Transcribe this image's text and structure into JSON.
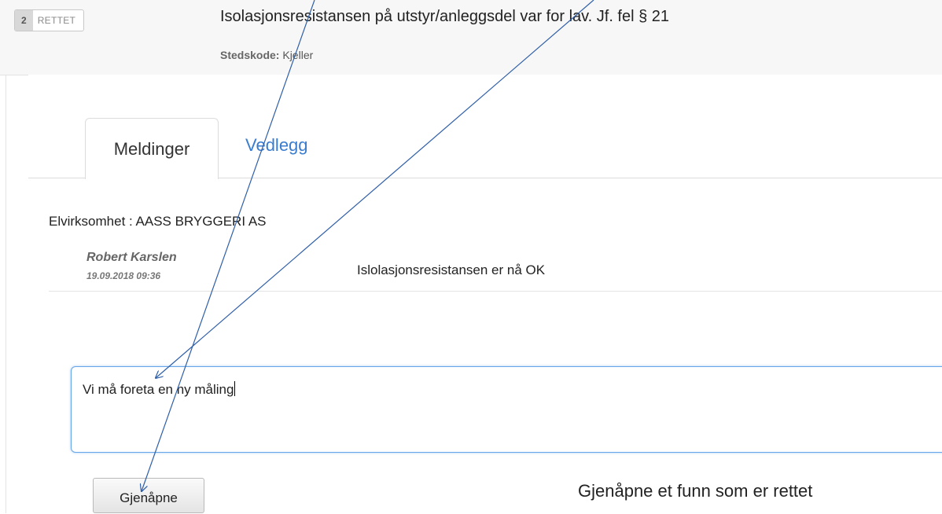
{
  "finding": {
    "number": "2",
    "status": "RETTET",
    "title": "Isolasjonsresistansen på utstyr/anleggsdel var for lav. Jf. fel § 21",
    "location_label": "Stedskode:",
    "location_value": "Kjeller"
  },
  "tabs": [
    {
      "label": "Meldinger",
      "active": true
    },
    {
      "label": "Vedlegg",
      "active": false
    }
  ],
  "messages": {
    "org_line": "Elvirksomhet : AASS BRYGGERI AS",
    "items": [
      {
        "author": "Robert Karslen",
        "timestamp": "19.09.2018 09:36",
        "text": "Islolasjonsresistansen er nå OK"
      }
    ]
  },
  "reply": {
    "value": "Vi må foreta en ny måling"
  },
  "actions": {
    "reopen_label": "Gjenåpne"
  },
  "annotation": {
    "text": "Gjenåpne et funn som er rettet",
    "arrow_color": "#2f5fa8"
  },
  "colors": {
    "link": "#3a7ccf",
    "focus_border": "#66a6e8"
  }
}
